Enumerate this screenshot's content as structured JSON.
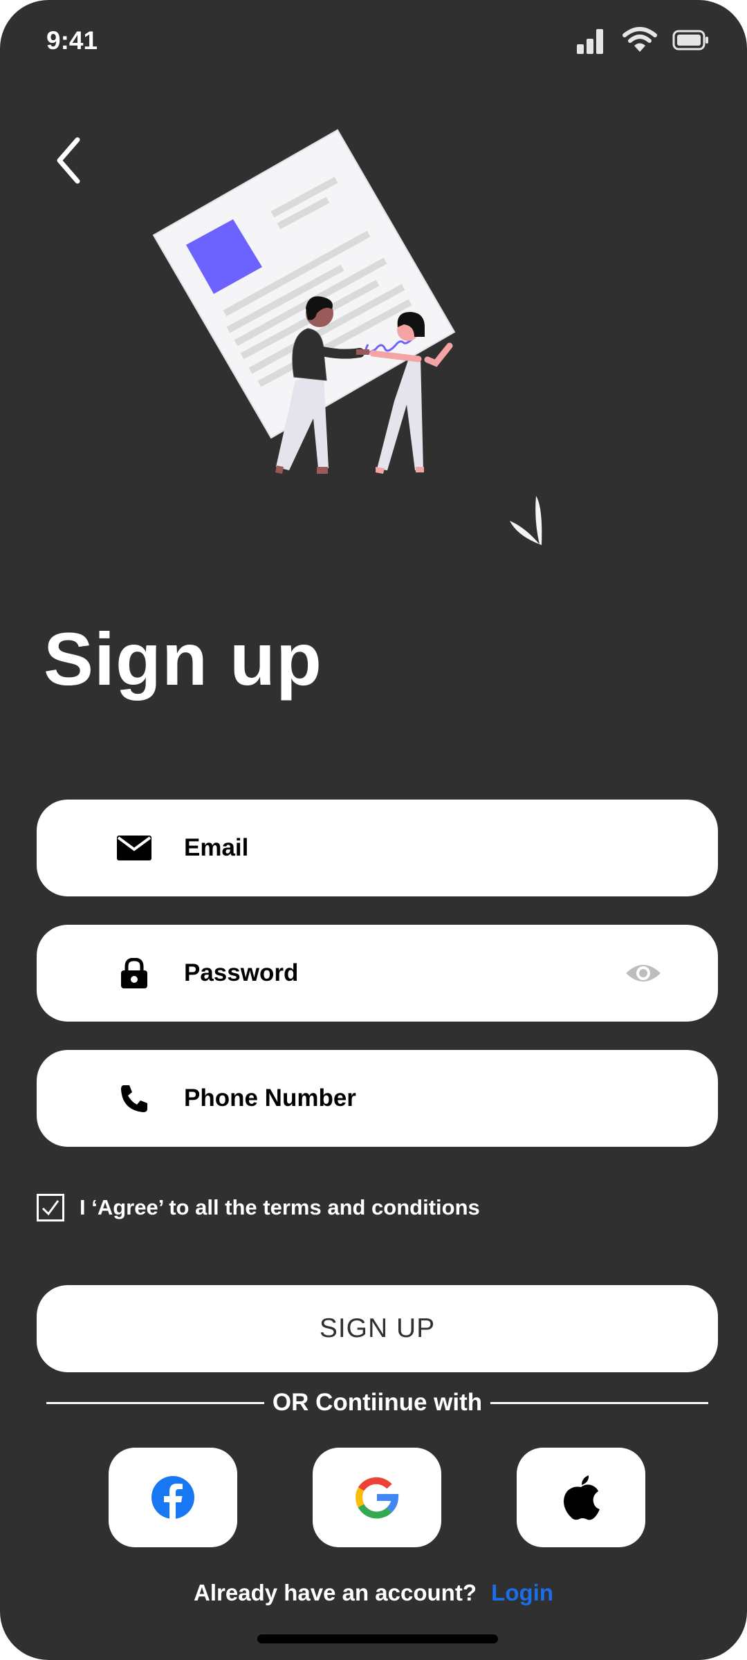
{
  "status_bar": {
    "time": "9:41",
    "icons": [
      "cellular-signal-icon",
      "wifi-icon",
      "battery-icon"
    ]
  },
  "header": {
    "back_icon": "chevron-left-icon"
  },
  "title": "Sign up",
  "fields": {
    "email": {
      "placeholder": "Email",
      "icon": "envelope-icon"
    },
    "password": {
      "placeholder": "Password",
      "icon": "lock-icon",
      "toggle_icon": "eye-icon"
    },
    "phone": {
      "placeholder": "Phone Number",
      "icon": "phone-icon"
    }
  },
  "agree": {
    "checked": true,
    "label": "I ‘Agree’ to all the terms and conditions"
  },
  "signup_button": "SIGN UP",
  "divider_text": "OR Contiinue with",
  "social": [
    "facebook-icon",
    "google-icon",
    "apple-icon"
  ],
  "footer": {
    "prompt": "Already have an account?",
    "login": "Login"
  },
  "colors": {
    "background": "#303031",
    "card": "#ffffff",
    "accent_link": "#1a6fe8",
    "illustration_accent": "#6c63ff",
    "figure_skin": "#f4a4a4"
  }
}
